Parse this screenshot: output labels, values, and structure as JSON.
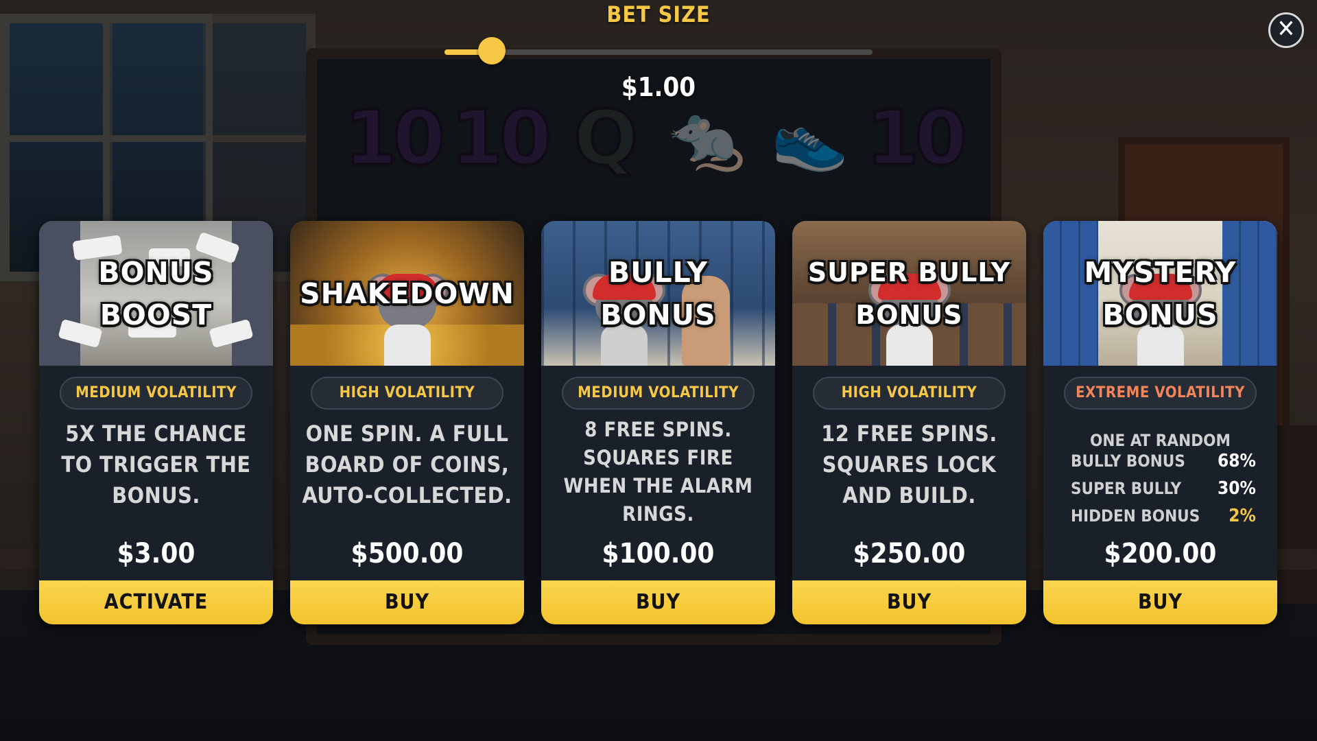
{
  "bet": {
    "title": "BET SIZE",
    "amount": "$1.00",
    "slider_level": 0.11
  },
  "colors": {
    "accent": "#f6c845",
    "card_bg": "#192029",
    "button": "#f6c845",
    "extreme": "#f2865a"
  },
  "reels": {
    "top_row": [
      "10",
      "10",
      "Q",
      "rat",
      "sneaker",
      "10"
    ]
  },
  "cards": [
    {
      "title": "BONUS BOOST",
      "volatility": "MEDIUM VOLATILITY",
      "description": "5X THE CHANCE TO TRIGGER THE BONUS.",
      "price": "$3.00",
      "button": "ACTIVATE"
    },
    {
      "title": "SHAKEDOWN",
      "volatility": "HIGH VOLATILITY",
      "description": "ONE SPIN. A FULL BOARD OF COINS, AUTO-COLLECTED.",
      "price": "$500.00",
      "button": "BUY"
    },
    {
      "title": "BULLY BONUS",
      "volatility": "MEDIUM VOLATILITY",
      "description": "8 FREE SPINS. SQUARES FIRE WHEN THE ALARM RINGS.",
      "price": "$100.00",
      "button": "BUY"
    },
    {
      "title": "SUPER BULLY BONUS",
      "volatility": "HIGH VOLATILITY",
      "description": "12 FREE SPINS. SQUARES LOCK AND BUILD.",
      "price": "$250.00",
      "button": "BUY"
    },
    {
      "title": "MYSTERY BONUS",
      "volatility": "EXTREME VOLATILITY",
      "odds_heading": "ONE AT RANDOM",
      "odds": [
        {
          "label": "BULLY BONUS",
          "pct": "68%"
        },
        {
          "label": "SUPER BULLY",
          "pct": "30%"
        },
        {
          "label": "HIDDEN BONUS",
          "pct": "2%"
        }
      ],
      "price": "$200.00",
      "button": "BUY"
    }
  ]
}
